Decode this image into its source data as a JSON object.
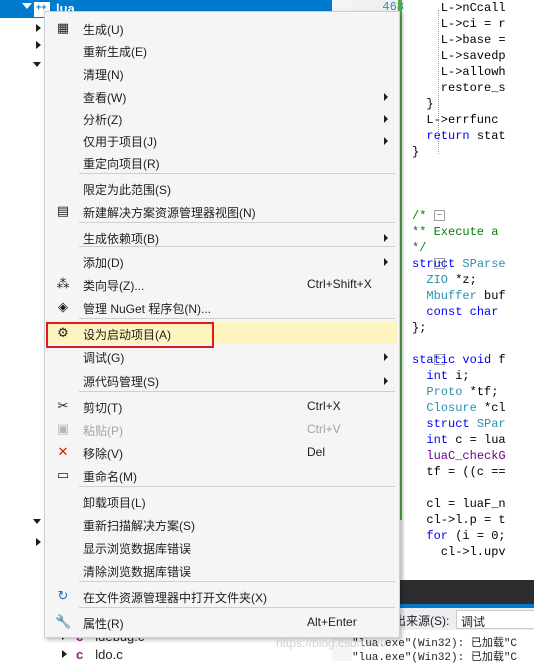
{
  "solution": {
    "selected_project": "lua",
    "files": [
      "ldebug.c",
      "ldo.c"
    ]
  },
  "editor": {
    "line_numbers": [
      "468",
      "",
      "",
      "",
      "",
      "",
      "",
      "",
      "",
      "",
      "",
      "",
      "",
      "",
      "",
      "",
      "",
      "",
      "",
      "",
      "",
      "",
      "",
      "",
      "",
      "",
      "",
      "",
      "",
      "",
      "",
      "",
      "",
      ""
    ],
    "lines": [
      {
        "t": "    L->nCcall",
        "c": ""
      },
      {
        "t": "    L->ci = r",
        "c": ""
      },
      {
        "t": "    L->base =",
        "c": ""
      },
      {
        "t": "    L->savedp",
        "c": ""
      },
      {
        "t": "    L->allowh",
        "c": ""
      },
      {
        "t": "    restore_s",
        "c": ""
      },
      {
        "t": "  }",
        "c": ""
      },
      {
        "t": "  L->errfunc",
        "c": ""
      },
      {
        "t": "  return stat",
        "c": "kw-first"
      },
      {
        "t": "}",
        "c": ""
      },
      {
        "t": "",
        "c": ""
      },
      {
        "t": "",
        "c": ""
      },
      {
        "t": "",
        "c": ""
      },
      {
        "t": "/*",
        "c": "cm"
      },
      {
        "t": "** Execute a",
        "c": "cm"
      },
      {
        "t": "*/",
        "c": "cm"
      },
      {
        "t": "struct SParse",
        "c": "struct"
      },
      {
        "t": "  ZIO *z;",
        "c": "type2"
      },
      {
        "t": "  Mbuffer buf",
        "c": "type2"
      },
      {
        "t": "  const char ",
        "c": "kw2"
      },
      {
        "t": "};",
        "c": ""
      },
      {
        "t": "",
        "c": ""
      },
      {
        "t": "static void f",
        "c": "static"
      },
      {
        "t": "  int i;",
        "c": "int"
      },
      {
        "t": "  Proto *tf;",
        "c": "type2"
      },
      {
        "t": "  Closure *cl",
        "c": "type2"
      },
      {
        "t": "  struct SPar",
        "c": "struct2"
      },
      {
        "t": "  int c = lua",
        "c": "int"
      },
      {
        "t": "  luaC_checkG",
        "c": "macro"
      },
      {
        "t": "  tf = ((c ==",
        "c": ""
      },
      {
        "t": "",
        "c": ""
      },
      {
        "t": "  cl = luaF_n",
        "c": ""
      },
      {
        "t": "  cl->l.p = t",
        "c": ""
      },
      {
        "t": "  for (i = 0;",
        "c": "for"
      },
      {
        "t": "    cl->l.upv",
        "c": ""
      }
    ]
  },
  "output": {
    "source_label": "出来源(S):",
    "source_value": "调试",
    "lines": [
      "\"lua.exe\"(Win32): 已加载\"C",
      "\"lua.exe\"(Win32): 已加载\"C"
    ]
  },
  "context_menu": {
    "items": [
      {
        "label": "生成(U)",
        "icon": "build-icon",
        "glyph": "▦"
      },
      {
        "label": "重新生成(E)"
      },
      {
        "label": "清理(N)"
      },
      {
        "label": "查看(W)",
        "submenu": true
      },
      {
        "label": "分析(Z)",
        "submenu": true
      },
      {
        "label": "仅用于项目(J)",
        "submenu": true
      },
      {
        "label": "重定向项目(R)"
      },
      {
        "label": "限定为此范围(S)"
      },
      {
        "label": "新建解决方案资源管理器视图(N)",
        "icon": "new-view-icon",
        "glyph": "▤"
      },
      {
        "label": "生成依赖项(B)",
        "submenu": true
      },
      {
        "label": "添加(D)",
        "submenu": true
      },
      {
        "label": "类向导(Z)...",
        "shortcut": "Ctrl+Shift+X",
        "icon": "class-wizard-icon",
        "glyph": "⁂"
      },
      {
        "label": "管理 NuGet 程序包(N)...",
        "icon": "nuget-icon",
        "glyph": "◈"
      },
      {
        "label": "设为启动项目(A)",
        "icon": "gear-icon",
        "glyph": "⚙"
      },
      {
        "label": "调试(G)",
        "submenu": true
      },
      {
        "label": "源代码管理(S)",
        "submenu": true
      },
      {
        "label": "剪切(T)",
        "shortcut": "Ctrl+X",
        "icon": "scissors-icon",
        "glyph": "✂"
      },
      {
        "label": "粘贴(P)",
        "shortcut": "Ctrl+V",
        "icon": "paste-icon",
        "glyph": "▣"
      },
      {
        "label": "移除(V)",
        "shortcut": "Del",
        "icon": "remove-icon",
        "glyph": "✕"
      },
      {
        "label": "重命名(M)",
        "icon": "rename-icon",
        "glyph": "▭"
      },
      {
        "label": "卸载项目(L)"
      },
      {
        "label": "重新扫描解决方案(S)"
      },
      {
        "label": "显示浏览数据库错误"
      },
      {
        "label": "清除浏览数据库错误"
      },
      {
        "label": "在文件资源管理器中打开文件夹(X)",
        "icon": "refresh-icon",
        "glyph": "↻"
      },
      {
        "label": "属性(R)",
        "shortcut": "Alt+Enter",
        "icon": "wrench-icon",
        "glyph": "🔧"
      }
    ]
  },
  "watermark": "https://blog.csdn.net/",
  "colors": {
    "selection": "#007acc",
    "menu_bg": "#f5f5f5",
    "menu_hover": "#fdf4bf",
    "highlight_border": "#e01a1a",
    "remove_icon": "#e51400"
  }
}
